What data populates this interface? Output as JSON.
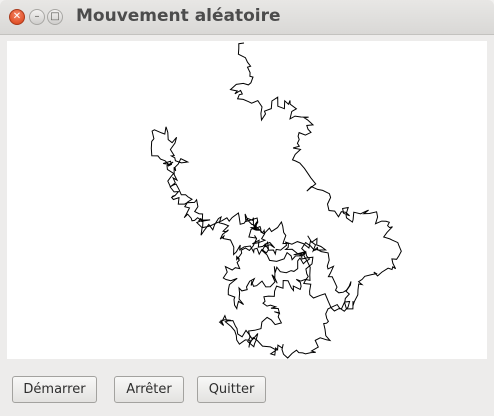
{
  "window": {
    "title": "Mouvement aléatoire",
    "controls": {
      "close_glyph": "✕",
      "minimize_glyph": "–",
      "maximize_glyph": "□"
    }
  },
  "canvas": {
    "background": "#ffffff",
    "line_color": "#000000"
  },
  "buttons": {
    "start_label": "Démarrer",
    "stop_label": "Arrêter",
    "quit_label": "Quitter"
  }
}
